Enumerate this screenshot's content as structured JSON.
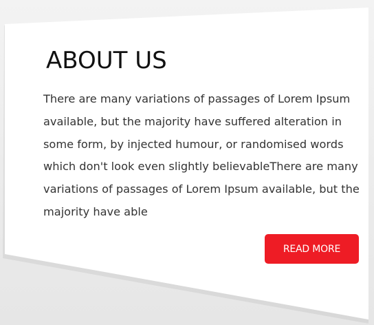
{
  "about": {
    "title": "ABOUT US",
    "description": "There are many variations of passages of Lorem Ipsum available, but the majority have suffered alteration in some form, by injected humour, or randomised words which don't look even slightly believableThere are many variations of passages of Lorem Ipsum available, but the majority have able",
    "button_label": "READ MORE"
  },
  "colors": {
    "accent": "#ee1c25",
    "card_background": "#ffffff",
    "page_background": "#ececec",
    "title_text": "#111111",
    "body_text": "#333333"
  }
}
